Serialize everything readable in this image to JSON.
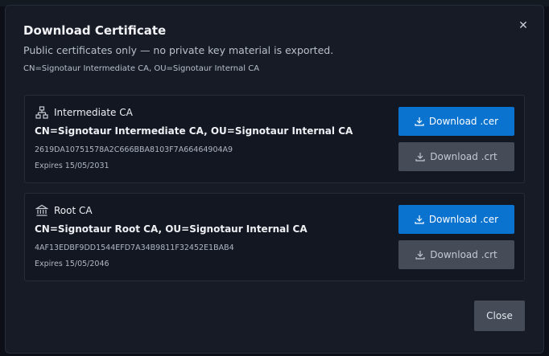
{
  "modal": {
    "title": "Download Certificate",
    "subtitle": "Public certificates only — no private key material is exported.",
    "subject": "CN=Signotaur Intermediate CA, OU=Signotaur Internal CA",
    "close_label": "Close"
  },
  "certificates": [
    {
      "name": "Intermediate CA",
      "icon": "hierarchy-icon",
      "subject": "CN=Signotaur Intermediate CA, OU=Signotaur Internal CA",
      "thumbprint": "2619DA10751578A2C666BBA8103F7A66464904A9",
      "expires": "Expires 15/05/2031",
      "download_cer_label": "Download .cer",
      "download_crt_label": "Download .crt"
    },
    {
      "name": "Root CA",
      "icon": "bank-icon",
      "subject": "CN=Signotaur Root CA, OU=Signotaur Internal CA",
      "thumbprint": "4AF13EDBF9DD1544EFD7A34B9811F32452E1BAB4",
      "expires": "Expires 15/05/2046",
      "download_cer_label": "Download .cer",
      "download_crt_label": "Download .crt"
    }
  ],
  "colors": {
    "primary": "#0a72cf",
    "secondary": "#454c58",
    "modal_bg": "#161b26",
    "card_bg": "#121722"
  }
}
